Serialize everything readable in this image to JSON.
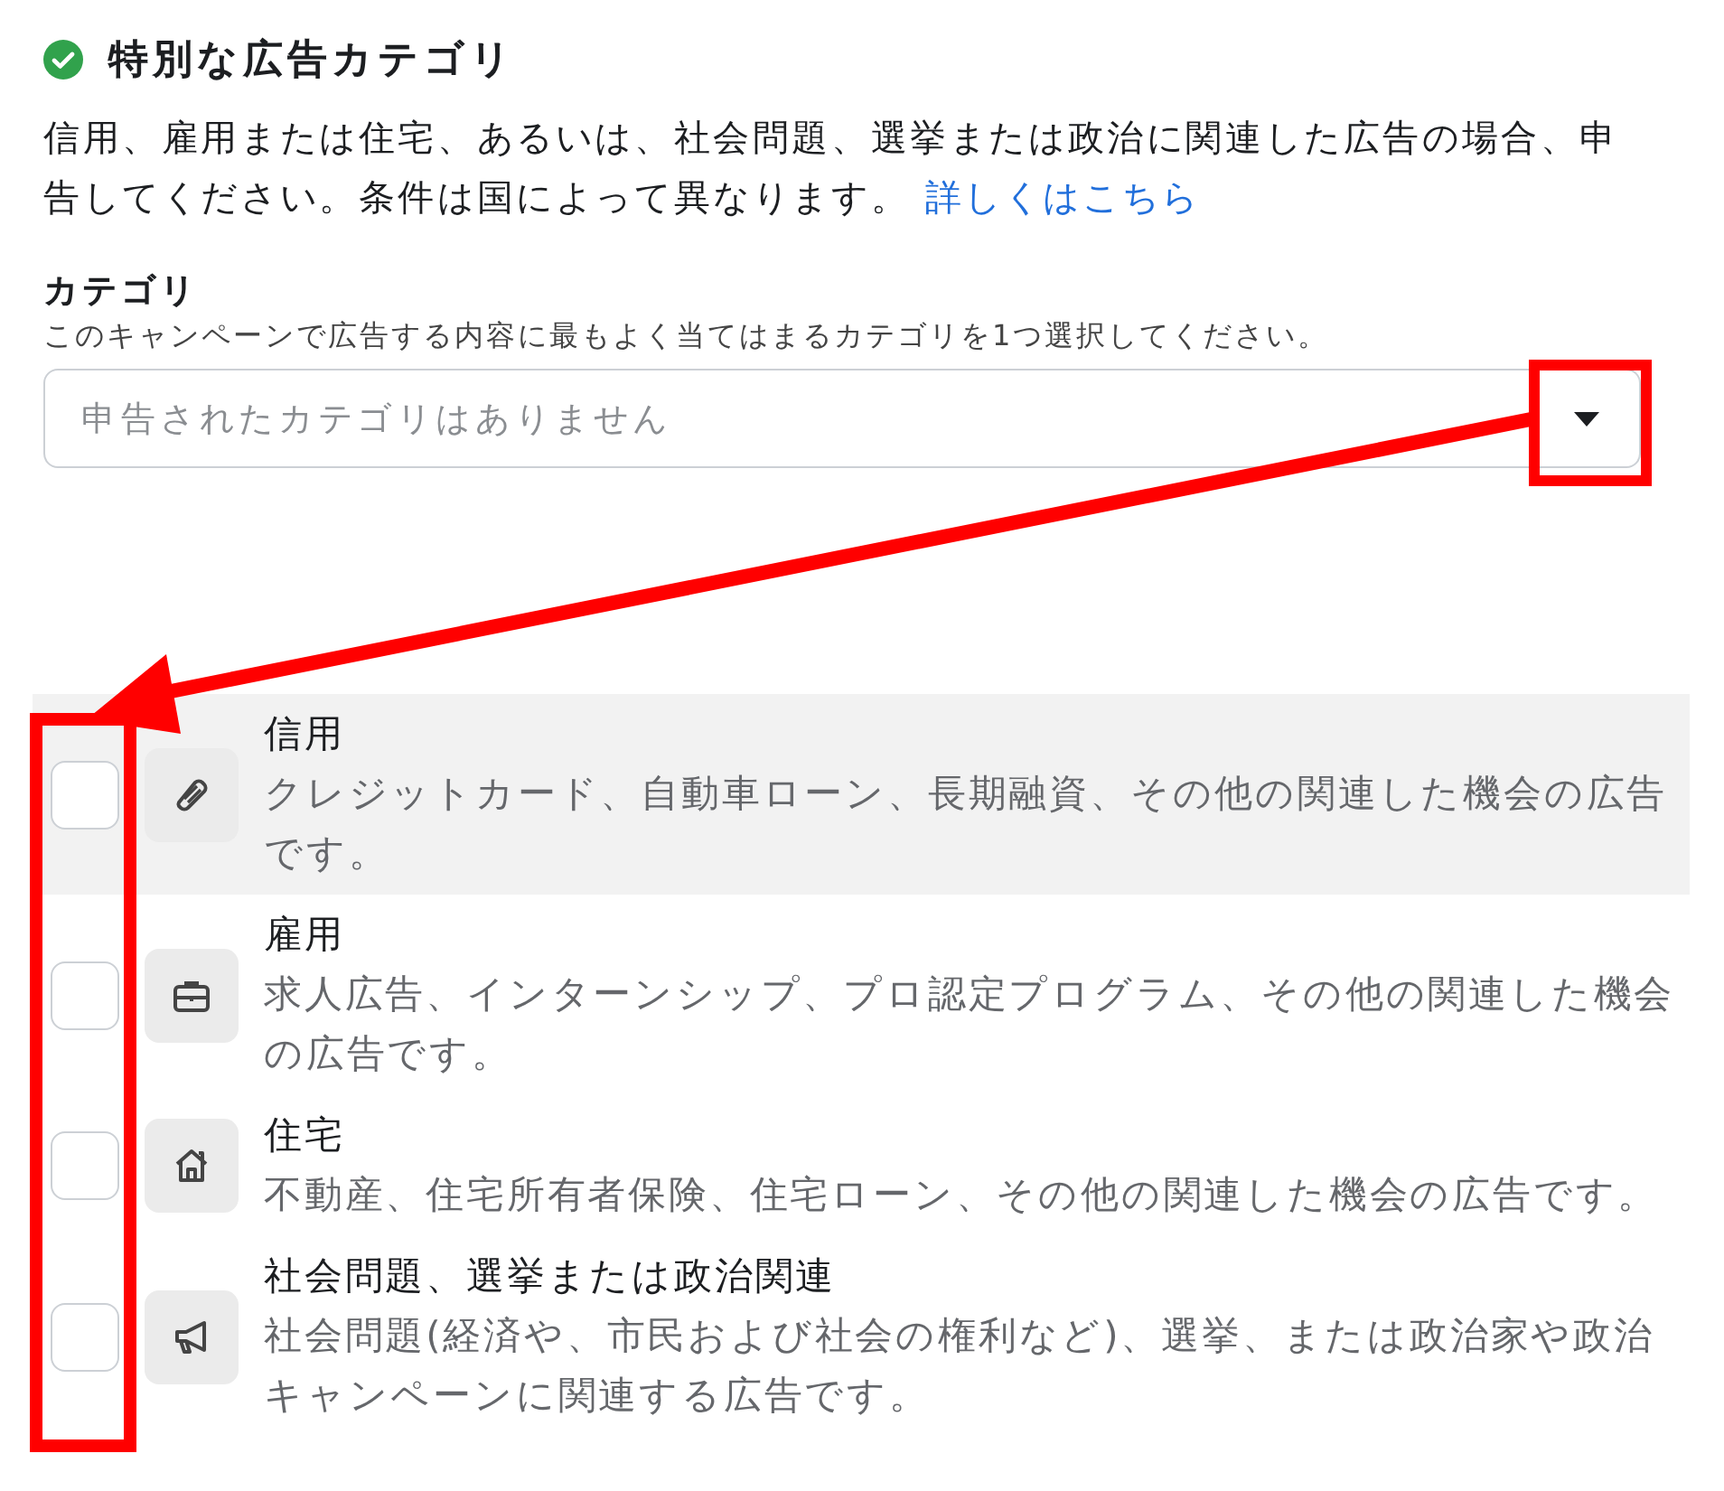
{
  "section": {
    "title": "特別な広告カテゴリ",
    "complete": true,
    "description": "信用、雇用または住宅、あるいは、社会問題、選挙または政治に関連した広告の場合、申告してください。条件は国によって異なります。",
    "link": "詳しくはこちら"
  },
  "category_field": {
    "label": "カテゴリ",
    "hint": "このキャンペーンで広告する内容に最もよく当てはまるカテゴリを1つ選択してください。",
    "placeholder": "申告されたカテゴリはありません"
  },
  "options": [
    {
      "kind": "credit",
      "title": "信用",
      "description": "クレジットカード、自動車ローン、長期融資、その他の関連した機会の広告です。",
      "checked": false,
      "highlighted": true
    },
    {
      "kind": "employment",
      "title": "雇用",
      "description": "求人広告、インターンシップ、プロ認定プログラム、その他の関連した機会の広告です。",
      "checked": false,
      "highlighted": false
    },
    {
      "kind": "housing",
      "title": "住宅",
      "description": "不動産、住宅所有者保険、住宅ローン、その他の関連した機会の広告です。",
      "checked": false,
      "highlighted": false
    },
    {
      "kind": "social",
      "title": "社会問題、選挙または政治関連",
      "description": "社会問題(経済や、市民および社会の権利など)、選挙、または政治家や政治キャンペーンに関連する広告です。",
      "checked": false,
      "highlighted": false
    }
  ]
}
